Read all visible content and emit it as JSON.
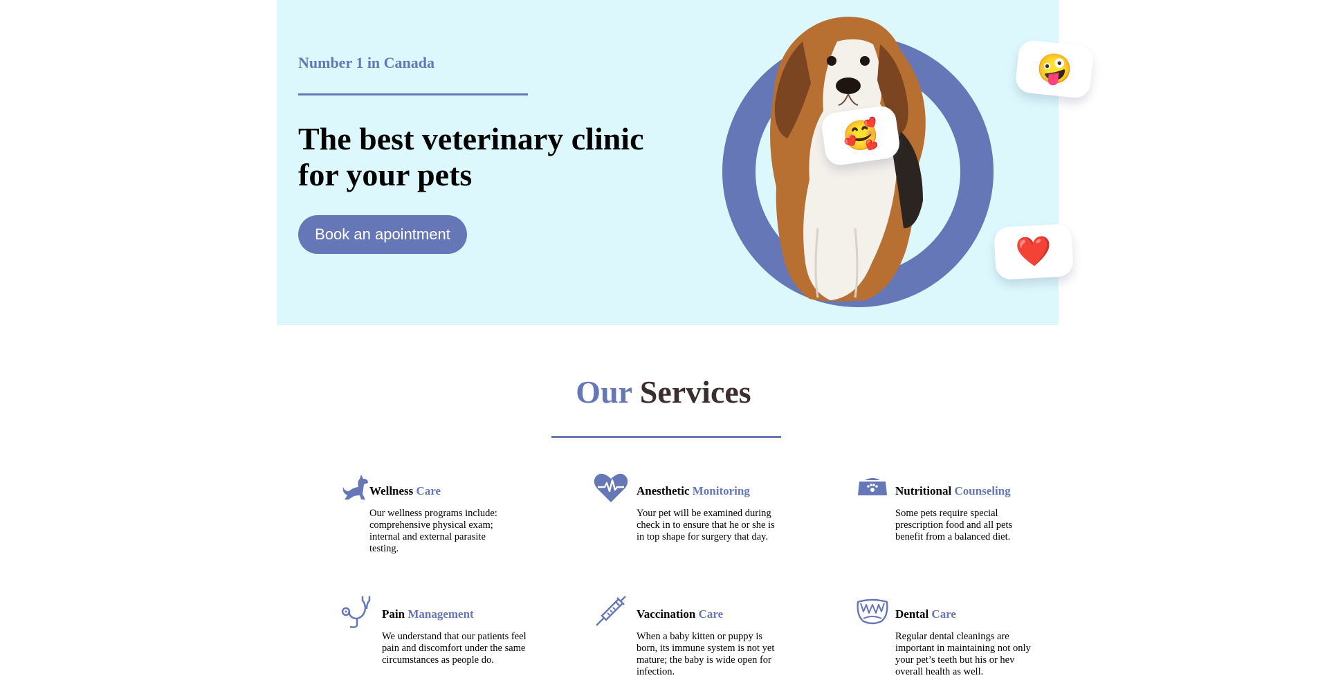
{
  "hero": {
    "tagline": "Number 1 in Canada",
    "title": "The best veterinary clinic for your pets",
    "cta_label": "Book an apointment",
    "emojis": {
      "top_right": "🤪",
      "left": "🥰",
      "bottom_right": "❤️"
    },
    "colors": {
      "background": "#ddf8fd",
      "accent": "#6677b8"
    }
  },
  "services": {
    "title_accent": "Our",
    "title_rest": "Services",
    "items": [
      {
        "icon": "dog-icon",
        "title_bold": "Wellness",
        "title_accent": "Care",
        "description": "Our wellness programs include: comprehensive physical exam; internal and external parasite testing."
      },
      {
        "icon": "heartbeat-icon",
        "title_bold": "Anesthetic",
        "title_accent": "Monitoring",
        "description": "Your pet will be examined during check in to ensure that he or she is in top shape for surgery that day."
      },
      {
        "icon": "pet-bowl-icon",
        "title_bold": "Nutritional",
        "title_accent": "Counseling",
        "description": "Some pets require special prescription food and all pets benefit from a balanced diet."
      },
      {
        "icon": "stethoscope-icon",
        "title_bold": "Pain",
        "title_accent": "Management",
        "description": "We understand that our patients feel pain and discomfort under the same circumstances as people do."
      },
      {
        "icon": "syringe-icon",
        "title_bold": "Vaccination",
        "title_accent": "Care",
        "description": "When a baby kitten or puppy is born, its immune system is not yet mature; the baby is wide open for infection."
      },
      {
        "icon": "teeth-icon",
        "title_bold": "Dental",
        "title_accent": "Care",
        "description": "Regular dental cleanings are important in maintaining not only your pet’s teeth but his or hev overall health as well."
      }
    ]
  }
}
